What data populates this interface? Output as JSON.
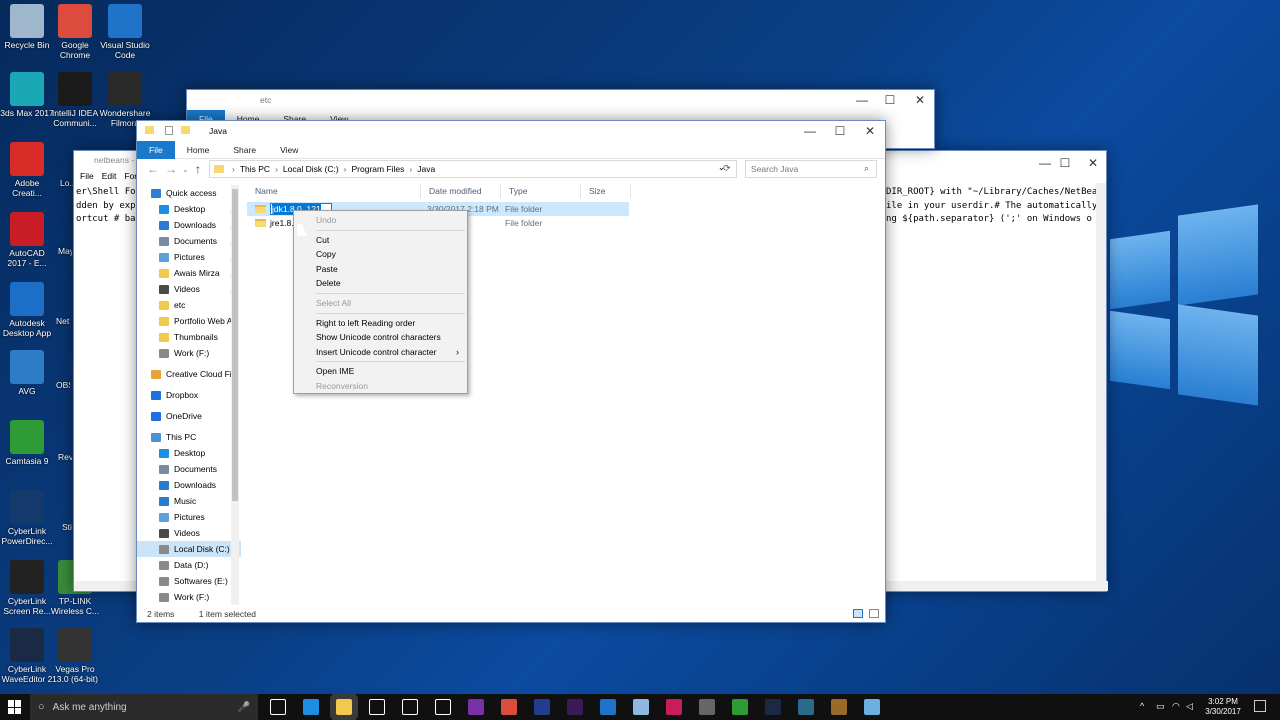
{
  "desktop_icons": [
    {
      "label": "Recycle Bin",
      "color": "#9fb7cc"
    },
    {
      "label": "Google Chrome",
      "color": "#dd4b3e"
    },
    {
      "label": "Visual Studio Code",
      "color": "#1f73c8"
    },
    {
      "label": "3ds Max 2017",
      "color": "#1aa8b4"
    },
    {
      "label": "IntelliJ IDEA Communi...",
      "color": "#1a1a1a"
    },
    {
      "label": "Wondershare Filmora",
      "color": "#2a2a2a"
    },
    {
      "label": "Adobe Creati...",
      "color": "#d92b27"
    },
    {
      "label": "AutoCAD 2017 - E...",
      "color": "#c81d25"
    },
    {
      "label": "Autodesk Desktop App",
      "color": "#1c6ec7"
    },
    {
      "label": "AVG",
      "color": "#2e7bc7"
    },
    {
      "label": "Camtasia 9",
      "color": "#2d9c36"
    },
    {
      "label": "CyberLink PowerDirec...",
      "color": "#133a6b"
    },
    {
      "label": "CyberLink Screen Re...",
      "color": "#222"
    },
    {
      "label": "TP-LINK Wireless C...",
      "color": "#3a8b3a"
    },
    {
      "label": "CyberLink WaveEditor 2",
      "color": "#1b2a44"
    },
    {
      "label": "Vegas Pro 13.0 (64-bit)",
      "color": "#333"
    }
  ],
  "partial_icon_labels": [
    "Lo...",
    "May",
    "NetBe 8.",
    "OBS",
    "Revi",
    "Sti"
  ],
  "etc_window": {
    "title": "etc",
    "tabs": [
      "File",
      "Home",
      "Share",
      "View"
    ]
  },
  "netbeans_window": {
    "title": "netbeans - N",
    "menu": [
      "File",
      "Edit",
      "Form"
    ],
    "left_lines": [
      "er\\Shell Fo",
      "dden by exp",
      "ortcut # ba"
    ],
    "right_lines": [
      "DIR_ROOT} with \"~/Library/Caches/NetBea",
      "ile in your userdir.# The automatically",
      "ng ${path.separator} (';' on Windows o"
    ]
  },
  "java_window": {
    "title": "Java",
    "tabs": [
      "File",
      "Home",
      "Share",
      "View"
    ],
    "path": [
      "This PC",
      "Local Disk (C:)",
      "Program Files",
      "Java"
    ],
    "search_placeholder": "Search Java",
    "columns": [
      "Name",
      "Date modified",
      "Type",
      "Size"
    ],
    "rows": [
      {
        "name": "jdk1.8.0_121",
        "date": "3/30/2017 2:18 PM",
        "type": "File folder"
      },
      {
        "name": "jre1.8.0",
        "date": "18 PM",
        "type": "File folder"
      }
    ],
    "nav": [
      {
        "label": "Quick access",
        "color": "#2f7fd1",
        "indent": 0,
        "pin": false
      },
      {
        "label": "Desktop",
        "color": "#1e8fe0",
        "indent": 1,
        "pin": true
      },
      {
        "label": "Downloads",
        "color": "#2a7ad0",
        "indent": 1,
        "pin": true
      },
      {
        "label": "Documents",
        "color": "#7a8ba0",
        "indent": 1,
        "pin": true
      },
      {
        "label": "Pictures",
        "color": "#5fa0d8",
        "indent": 1,
        "pin": true
      },
      {
        "label": "Awais Mirza",
        "color": "#f2c94c",
        "indent": 1,
        "pin": true
      },
      {
        "label": "Videos",
        "color": "#4a4a4a",
        "indent": 1,
        "pin": true
      },
      {
        "label": "etc",
        "color": "#f2c94c",
        "indent": 1,
        "pin": false
      },
      {
        "label": "Portfolio Web A",
        "color": "#f2c94c",
        "indent": 1,
        "pin": false
      },
      {
        "label": "Thumbnails",
        "color": "#f2c94c",
        "indent": 1,
        "pin": false
      },
      {
        "label": "Work (F:)",
        "color": "#8a8a8a",
        "indent": 1,
        "pin": false
      },
      {
        "label": "",
        "color": "transparent",
        "indent": 0,
        "pin": false
      },
      {
        "label": "Creative Cloud Fil",
        "color": "#e8a23a",
        "indent": 0,
        "pin": false
      },
      {
        "label": "",
        "color": "transparent",
        "indent": 0,
        "pin": false
      },
      {
        "label": "Dropbox",
        "color": "#1f6fe0",
        "indent": 0,
        "pin": false
      },
      {
        "label": "",
        "color": "transparent",
        "indent": 0,
        "pin": false
      },
      {
        "label": "OneDrive",
        "color": "#1f6fe0",
        "indent": 0,
        "pin": false
      },
      {
        "label": "",
        "color": "transparent",
        "indent": 0,
        "pin": false
      },
      {
        "label": "This PC",
        "color": "#4a90d9",
        "indent": 0,
        "pin": false
      },
      {
        "label": "Desktop",
        "color": "#1e8fe0",
        "indent": 1,
        "pin": false
      },
      {
        "label": "Documents",
        "color": "#7a8ba0",
        "indent": 1,
        "pin": false
      },
      {
        "label": "Downloads",
        "color": "#2a7ad0",
        "indent": 1,
        "pin": false
      },
      {
        "label": "Music",
        "color": "#2a7ad0",
        "indent": 1,
        "pin": false
      },
      {
        "label": "Pictures",
        "color": "#5fa0d8",
        "indent": 1,
        "pin": false
      },
      {
        "label": "Videos",
        "color": "#4a4a4a",
        "indent": 1,
        "pin": false
      },
      {
        "label": "Local Disk (C:)",
        "color": "#8a8a8a",
        "indent": 1,
        "pin": false,
        "selected": true
      },
      {
        "label": "Data (D:)",
        "color": "#8a8a8a",
        "indent": 1,
        "pin": false
      },
      {
        "label": "Softwares (E:)",
        "color": "#8a8a8a",
        "indent": 1,
        "pin": false
      },
      {
        "label": "Work (F:)",
        "color": "#8a8a8a",
        "indent": 1,
        "pin": false
      }
    ],
    "status_items": "2 items",
    "status_selected": "1 item selected"
  },
  "context_menu": {
    "groups": [
      [
        {
          "label": "Undo",
          "disabled": true
        }
      ],
      [
        {
          "label": "Cut"
        },
        {
          "label": "Copy"
        },
        {
          "label": "Paste"
        },
        {
          "label": "Delete"
        }
      ],
      [
        {
          "label": "Select All",
          "disabled": true
        }
      ],
      [
        {
          "label": "Right to left Reading order"
        },
        {
          "label": "Show Unicode control characters"
        },
        {
          "label": "Insert Unicode control character",
          "submenu": true
        }
      ],
      [
        {
          "label": "Open IME"
        },
        {
          "label": "Reconversion",
          "disabled": true
        }
      ]
    ]
  },
  "taskbar": {
    "search_placeholder": "Ask me anything",
    "time": "3:02 PM",
    "date": "3/30/2017",
    "apps": [
      "task-view",
      "edge",
      "file-explorer",
      "mail",
      "store",
      "camera",
      "onenote",
      "chrome",
      "photoshop",
      "premiere",
      "vscode",
      "3d",
      "intellij",
      "obs",
      "camtasia",
      "cyberlink",
      "filmora",
      "netbeans",
      "wireless"
    ],
    "app_colors": [
      "#fff",
      "#1e8fe0",
      "#f2c94c",
      "#fff",
      "#fff",
      "#fff",
      "#7b2fa8",
      "#dd4b3e",
      "#1f3f8c",
      "#3b1a5a",
      "#1f73c8",
      "#8fb8e0",
      "#c81d5c",
      "#666",
      "#2d9c36",
      "#1b2a44",
      "#2a6a8a",
      "#9a6a2a",
      "#6ab0e0"
    ]
  }
}
